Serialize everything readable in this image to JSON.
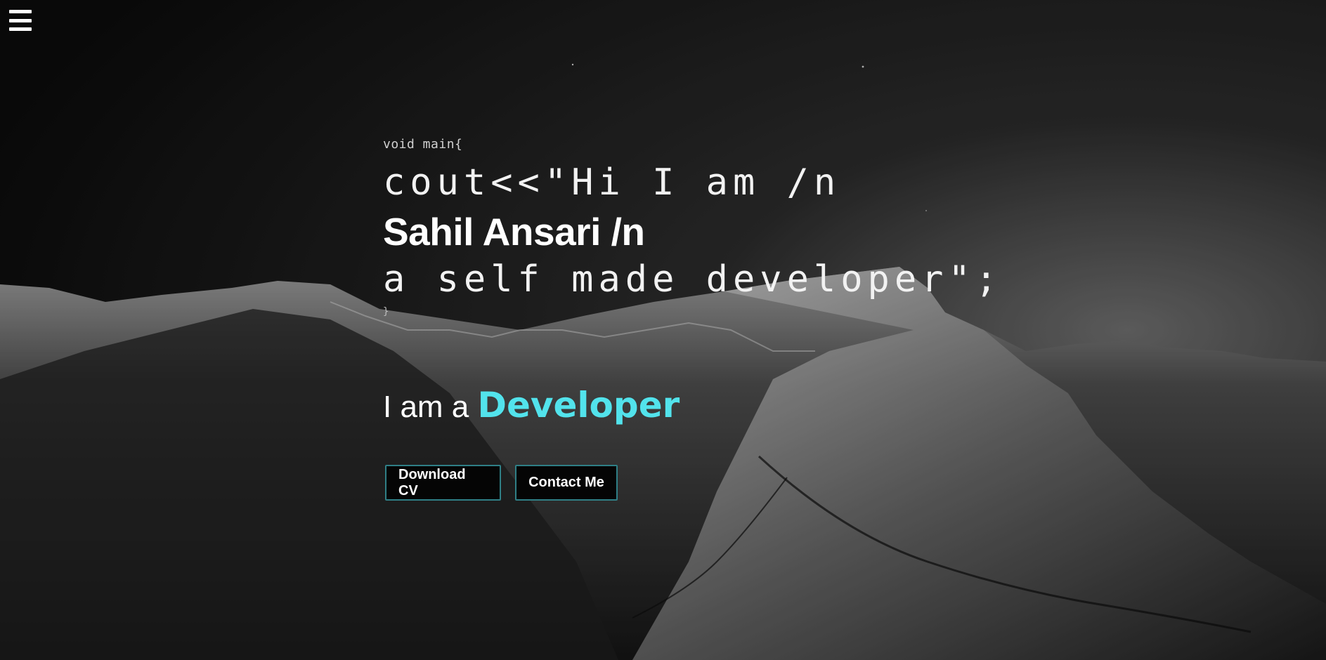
{
  "nav": {
    "menu_icon": "hamburger-menu-icon"
  },
  "hero": {
    "code_open": "void main{",
    "code_line_1": "cout<<\"Hi I am /n",
    "name_line": "Sahil Ansari /n",
    "code_line_2": "a self made developer\";",
    "code_close": "}"
  },
  "role": {
    "prefix": "I am a ",
    "title": "Developer"
  },
  "actions": {
    "download_cv_label": "Download CV",
    "contact_label": "Contact Me"
  },
  "colors": {
    "accent": "#52e3ec",
    "button_border": "#2f7f86",
    "background": "#0a0a0a"
  }
}
